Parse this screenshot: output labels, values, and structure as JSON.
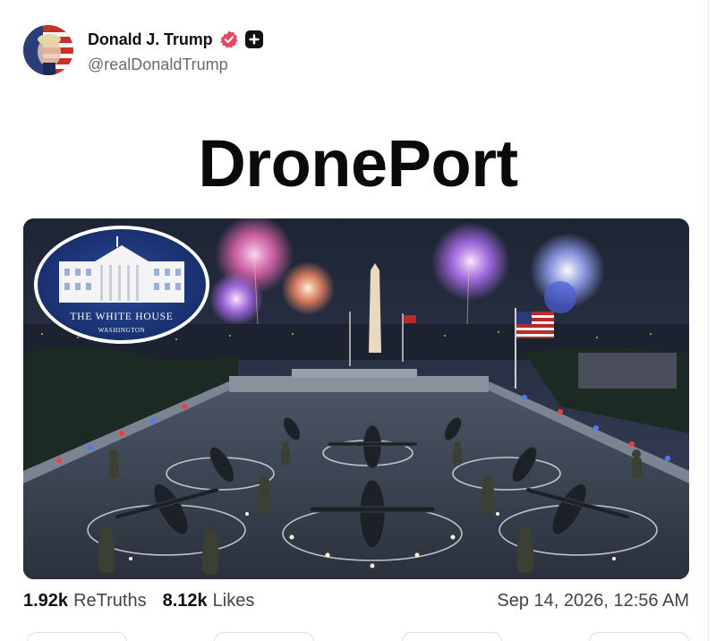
{
  "post": {
    "display_name": "Donald J. Trump",
    "handle": "@realDonaldTrump",
    "verified_icon": "verified-check-icon",
    "plus_icon": "plus-icon",
    "headline": "DronePort",
    "image": {
      "seal_title": "THE WHITE HOUSE",
      "seal_subtitle": "WASHINGTON"
    },
    "stats": {
      "retruths_count": "1.92k",
      "retruths_label": "ReTruths",
      "likes_count": "8.12k",
      "likes_label": "Likes"
    },
    "timestamp": "Sep 14, 2026, 12:56 AM"
  },
  "colors": {
    "verified_badge": "#e8475f",
    "text_primary": "#111111",
    "text_secondary": "#6b6b6b"
  }
}
